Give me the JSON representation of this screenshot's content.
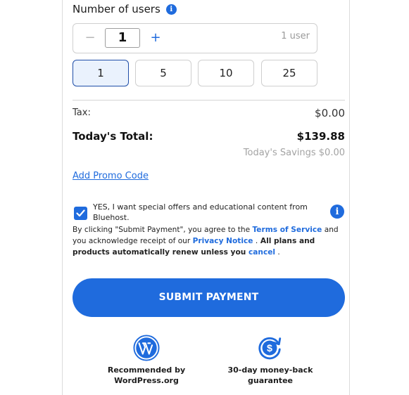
{
  "users": {
    "heading": "Number of users",
    "info_icon": "info-icon",
    "minus_label": "−",
    "quantity": "1",
    "plus_label": "+",
    "user_count_label": "1 user",
    "presets": [
      "1",
      "5",
      "10",
      "25"
    ],
    "selected_preset": "1"
  },
  "summary": {
    "tax_label": "Tax:",
    "tax_value": "$0.00",
    "total_label": "Today's Total:",
    "total_value": "$139.88",
    "savings_label": "Today's Savings $0.00"
  },
  "promo": {
    "link_label": "Add Promo Code"
  },
  "optin": {
    "checked": true,
    "text": "YES, I want special offers and educational content from Bluehost."
  },
  "legal": {
    "part1": "By clicking \"Submit Payment\", you agree to the ",
    "terms_link": "Terms of Service",
    "part2": " and you acknowledge receipt of our ",
    "privacy_link": "Privacy Notice",
    "part3": " .",
    "strong_text": " All plans and products automatically renew unless you ",
    "cancel_link": "cancel",
    "part4": " ."
  },
  "submit": {
    "label": "SUBMIT PAYMENT"
  },
  "badges": [
    {
      "icon": "wordpress-icon",
      "line1": "Recommended by",
      "line2": "WordPress.org"
    },
    {
      "icon": "money-back-icon",
      "line1": "30-day money-back",
      "line2": "guarantee"
    }
  ],
  "colors": {
    "accent": "#1f6bdd",
    "selected_bg": "#eaf2fd",
    "selected_border": "#1f4ea8",
    "muted_text": "#a3a3a3"
  }
}
